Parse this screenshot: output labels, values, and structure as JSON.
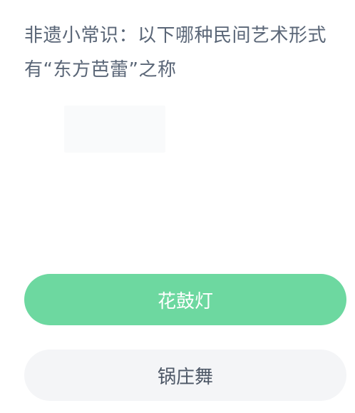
{
  "question": {
    "text": "非遗小常识：以下哪种民间艺术形式有“东方芭蕾”之称"
  },
  "options": [
    {
      "label": "花鼓灯",
      "state": "selected"
    },
    {
      "label": "锅庄舞",
      "state": "normal"
    }
  ],
  "colors": {
    "question_text": "#5a6677",
    "selected_bg": "#6dd8a0",
    "selected_text": "#ffffff",
    "normal_bg": "#f4f5f7",
    "normal_text": "#4d5766",
    "page_bg": "#ffffff"
  }
}
